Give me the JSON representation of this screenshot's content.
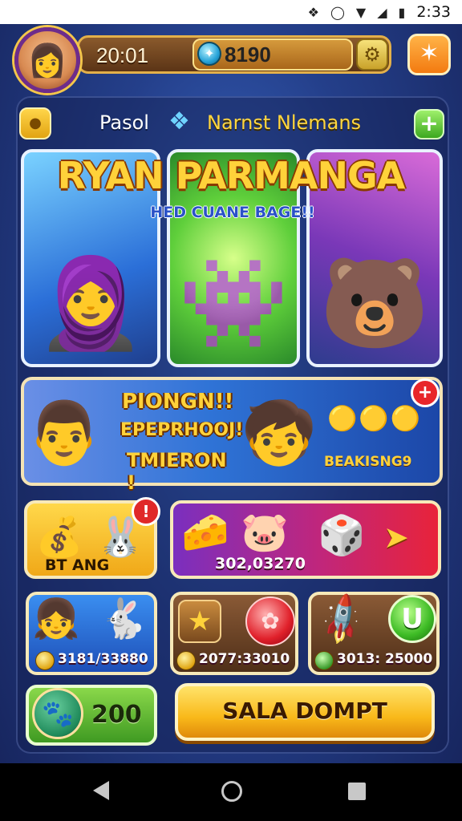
{
  "status_bar": {
    "time": "2:33",
    "icons": [
      "nfc-icon",
      "alarm-icon",
      "wifi-icon",
      "signal-icon",
      "battery-icon"
    ]
  },
  "hud": {
    "timer": "20:01",
    "currency": "8190",
    "currency_icon": "gem-icon",
    "settings_icon": "gear-icon",
    "favorite_icon": "star-icon"
  },
  "nav": {
    "left_label": "Pasol",
    "right_label": "Narnst Nlemans"
  },
  "hero": {
    "title": "RYAN PARMANGA",
    "subtitle": "HED CUANE BAGE!!",
    "cards": [
      "blue-warrior",
      "purple-creature",
      "brown-beast"
    ]
  },
  "promo": {
    "line1": "PIONGN!!",
    "line2": "EPEPRHOOJ!",
    "line3": "TMIERON !",
    "reward": "BEAKISNG9",
    "badge": "+"
  },
  "tiles": {
    "gold_label": "BT ANG",
    "gold_badge": "!",
    "red_value": "302,03270",
    "blue_value": "3181/33880",
    "brown1_value": "2077:33010",
    "brown2_value": "3013: 25000",
    "u_label": "U",
    "green_value": "200"
  },
  "cta": {
    "label": "SALA DOMPT"
  },
  "colors": {
    "accent_gold": "#ffd23a",
    "accent_green": "#3da81f",
    "accent_red": "#e02828",
    "bg_blue": "#243f8a"
  }
}
